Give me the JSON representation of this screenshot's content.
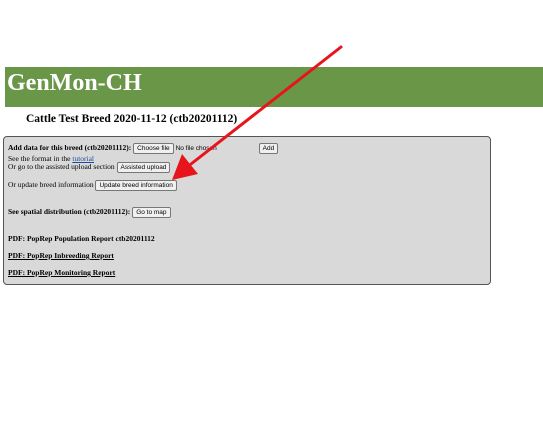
{
  "header": {
    "site_title": "GenMon-CH",
    "color": "#6a9648"
  },
  "breed": {
    "title": "Cattle Test Breed 2020-11-12 (ctb20201112)"
  },
  "panel": {
    "add_data_label": "Add data for this breed (ctb20201112):",
    "choose_file_button": "Choose file",
    "no_file_text": "No file chosen",
    "add_button": "Add",
    "format_text": "See the format in the",
    "tutorial_link": "tutorial",
    "assisted_label": "Or go to the assisted upload section",
    "assisted_button": "Assisted upload",
    "update_label": "Or update breed information",
    "update_button": "Update breed information",
    "spatial_label": "See spatial distribution (ctb20201112):",
    "go_map_button": "Go to map",
    "report_population": "PDF: PopRep Population Report ctb20201112",
    "report_inbreeding": "PDF: PopRep Inbreeding Report",
    "report_monitoring": "PDF: PopRep Monitoring Report"
  },
  "annotation": {
    "arrow_color": "#e8141b",
    "arrow_icon": "red-arrow-icon"
  }
}
